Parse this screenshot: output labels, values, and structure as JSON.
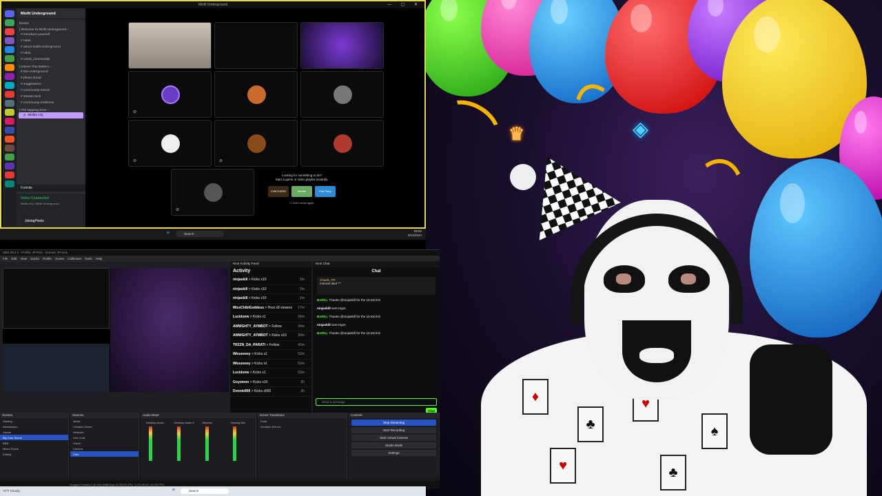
{
  "call_window": {
    "title": "Misfit Underground",
    "controls": "— ▢ ✕"
  },
  "discord": {
    "server_name": "Misfit Underground",
    "categories": [
      {
        "name": "Events"
      },
      {
        "name": "| Welcome To Misfit Underground ~"
      },
      {
        "name": "| Unless That Matters ~"
      },
      {
        "name": "| The Vapping Zone ~"
      }
    ],
    "channels": [
      "introduce-yourself",
      "rules",
      "about-misfit-underground",
      "roles",
      "unitol_communitis",
      "the-underground",
      "photo-dump",
      "suggestions",
      "community-merch",
      "stream-tech",
      "community-emblems"
    ],
    "voice_channel": "Misfits HQ",
    "voice_users": [
      "Fortnite"
    ],
    "fortnite_label": "Fortnite",
    "voice_status": "Video Connected",
    "voice_sub": "Misfits HQ / Misfit Underground",
    "user_name": "JokingPixels",
    "user_status": "Fortnite"
  },
  "suggestion": {
    "heading": "Looking for something to do?",
    "sub": "Start a game or video playlist instantly.",
    "games": [
      "CHECKERS",
      "Wordle",
      "Putt Party"
    ],
    "checkbox": "Don't show again"
  },
  "taskbar_top": {
    "search": "Search",
    "time": "09:50",
    "date": "9/14/2024"
  },
  "obs": {
    "title": "OBS 30.2.2 - Profile: JP Kick - Scenes: JP Kick",
    "menu": "File Edit View Docks Profile Scene Collection Tools Help",
    "activity_dock_title": "Kick Activity Feed",
    "activity_title": "Activity",
    "activity": [
      {
        "user": "ninjaskill",
        "action": "> Kicks x10",
        "time": "2m"
      },
      {
        "user": "ninjaskill",
        "action": "> Kicks x10",
        "time": "2m"
      },
      {
        "user": "ninjaskill",
        "action": "> Kicks x10",
        "time": "2m"
      },
      {
        "user": "MissChibiGoddess",
        "action": "> Host x8 viewers",
        "time": "17m"
      },
      {
        "user": "Lucidonw",
        "action": "> Kicks x1",
        "time": "26m"
      },
      {
        "user": "AWWGHTY_AYMBOT",
        "action": "> Follow",
        "time": "34m"
      },
      {
        "user": "AWWGHTY_AYMBOT",
        "action": "> Kicks x10",
        "time": "39m"
      },
      {
        "user": "TRZZN_DA_PARATI",
        "action": "> Follow",
        "time": "42m"
      },
      {
        "user": "iMouseeey",
        "action": "> Kicks x1",
        "time": "52m"
      },
      {
        "user": "iMouseeey",
        "action": "> Kicks x1",
        "time": "52m"
      },
      {
        "user": "Lucidonw",
        "action": "> Kicks x1",
        "time": "52m"
      },
      {
        "user": "Goyomon",
        "action": "> Kicks x10",
        "time": "2h"
      },
      {
        "user": "Donnie800",
        "action": "> Kicks x500",
        "time": "2h"
      }
    ],
    "chat_dock_title": "Kick Chat",
    "chat_title": "Chat",
    "pinned_user": "Chadis_PR",
    "pinned_msg": "Internet died ^^",
    "chat": [
      {
        "user": "BotRix:",
        "text": "Thanks @ninjaskill for the 10 KICKs!"
      },
      {
        "user": "ninjaskill",
        "text": "sent Hype"
      },
      {
        "user": "BotRix:",
        "text": "Thanks @ninjaskill for the 10 KICKs!"
      },
      {
        "user": "ninjaskill",
        "text": "sent Hype"
      },
      {
        "user": "BotRix:",
        "text": "Thanks @ninjaskill for the 10 KICKs!"
      }
    ],
    "send_placeholder": "Send a message",
    "chat_button": "Chat",
    "docks": {
      "scenes_title": "Scenes",
      "scenes": [
        "Starting",
        "Intermission",
        "Gamer",
        "Big Cam Scene",
        "BRB",
        "Mixed Scene",
        "Ending"
      ],
      "sources_title": "Sources",
      "sources": [
        "Cam",
        "Alerts",
        "Creation Scene",
        "Webcam",
        "Kick Chat",
        "Game",
        "Camera"
      ],
      "mixer_title": "Audio Mixer",
      "mixer": [
        "Desktop Audio",
        "Desktop Audio 2",
        "Mic/Aux",
        "Gaming Mic"
      ],
      "transitions_title": "Scene Transitions",
      "transition": "Fade",
      "duration_label": "Duration",
      "duration": "300 ms",
      "controls_title": "Controls",
      "controls": [
        "Stop Streaming",
        "Start Recording",
        "Start Virtual Camera",
        "Studio Mode",
        "Settings"
      ]
    },
    "status": "Dropped Frames 0 (0.0%)   8468 kbps   00:00:00   CPU: 3.2%   60.00 / 60.00 FPS"
  },
  "taskbar_bottom": {
    "weather": "73°F Cloudy",
    "search": "Search"
  },
  "colors": {
    "kick_green": "#53fc18",
    "discord_purple": "#c59aff",
    "call_border": "#e7d84b",
    "obs_blue": "#2553c2"
  }
}
